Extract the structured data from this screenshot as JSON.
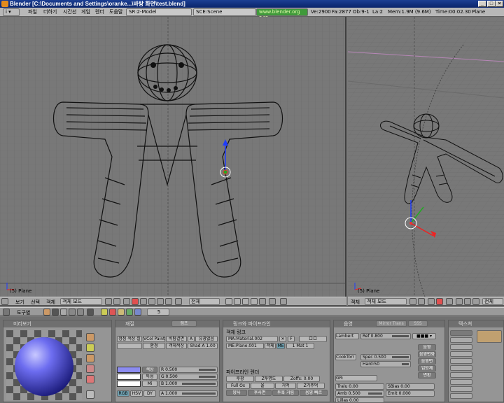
{
  "window": {
    "title": "Blender [C:\\Documents and Settings\\oranke...\\바탕 화면\\test.blend]"
  },
  "menubar": {
    "items": [
      "파일",
      "더하기",
      "시간선",
      "게임",
      "렌더",
      "도움말"
    ],
    "scene_model": "SR:2-Model",
    "scene": "SCE:Scene",
    "website": "www.blender.org 249",
    "stats": {
      "ve": "Ve:2900",
      "fa": "Fa:2877",
      "ob": "Ob:9-1",
      "la": "La:2",
      "mem": "Mem:1.9M (9.6M)",
      "time": "Time:00:02.30",
      "obj": "Plane"
    }
  },
  "viewport_left": {
    "object_label": "(5) Plane",
    "header": {
      "view": "보기",
      "select": "선택",
      "object": "객체",
      "mode": "객체 모드",
      "global": "전체"
    }
  },
  "viewport_right": {
    "object_label": "(5) Plane",
    "header": {
      "object": "객체",
      "mode": "객체 모드",
      "global": "전체"
    }
  },
  "buttons_header": {
    "panels": "도구별",
    "frame": "5"
  },
  "preview_panel": {
    "title": "미리보기"
  },
  "material_panel": {
    "title": "재질",
    "tab": "램프",
    "buttons": [
      [
        "정점 색상 칠",
        "VCol Paint",
        "비탐결면",
        "A",
        "유광없음"
      ],
      [
        "",
        "환경",
        "객체색상",
        "",
        "Shad A 1.00"
      ]
    ],
    "colors": {
      "col": "색상",
      "spe": "특성",
      "mir": "Mi"
    },
    "rgb": {
      "r": "R 0.500",
      "g": "G 0.500",
      "b": "B 1.000",
      "a": "A 1.000"
    },
    "modes": [
      "RGB",
      "HSV",
      "DY"
    ]
  },
  "links_panel": {
    "title": "링크와 파이프라인",
    "link_label": "객체 링크",
    "ma": "MA:Material.002",
    "f": "F",
    "obj": "객체",
    "me": "ME:Plane.001",
    "obj2": "객체",
    "me2": "ME",
    "mat": "1 Mat 1",
    "render_label": "파이프라인 렌더",
    "buttons": [
      "후광",
      "Z투명도",
      "Zoffs: 0.00",
      "Full Os",
      "올",
      "거먹",
      "Z기주먹",
      "양사",
      "후사면",
      "투혹 거림",
      "음영 빠르"
    ]
  },
  "shaders_panel": {
    "title": "음영",
    "tab": "Mirror Trans",
    "tab2": "SSS",
    "diffuse": "Lambert",
    "ref": "Ref  0.800",
    "spec_shader": "CookTorr",
    "spec": "Spec 0.500",
    "hard": "Hard:50",
    "rightbtns": [
      "음영",
      "음영변화",
      "음영면",
      "입방체",
      "변환"
    ],
    "gr": "GR:",
    "rows": [
      "Tralu 0.00",
      "SBias 0.00",
      "Amb 0.500",
      "Emit 0.000",
      "Lillas 0.00"
    ]
  },
  "texture_panel": {
    "title": "텍스쳐"
  }
}
